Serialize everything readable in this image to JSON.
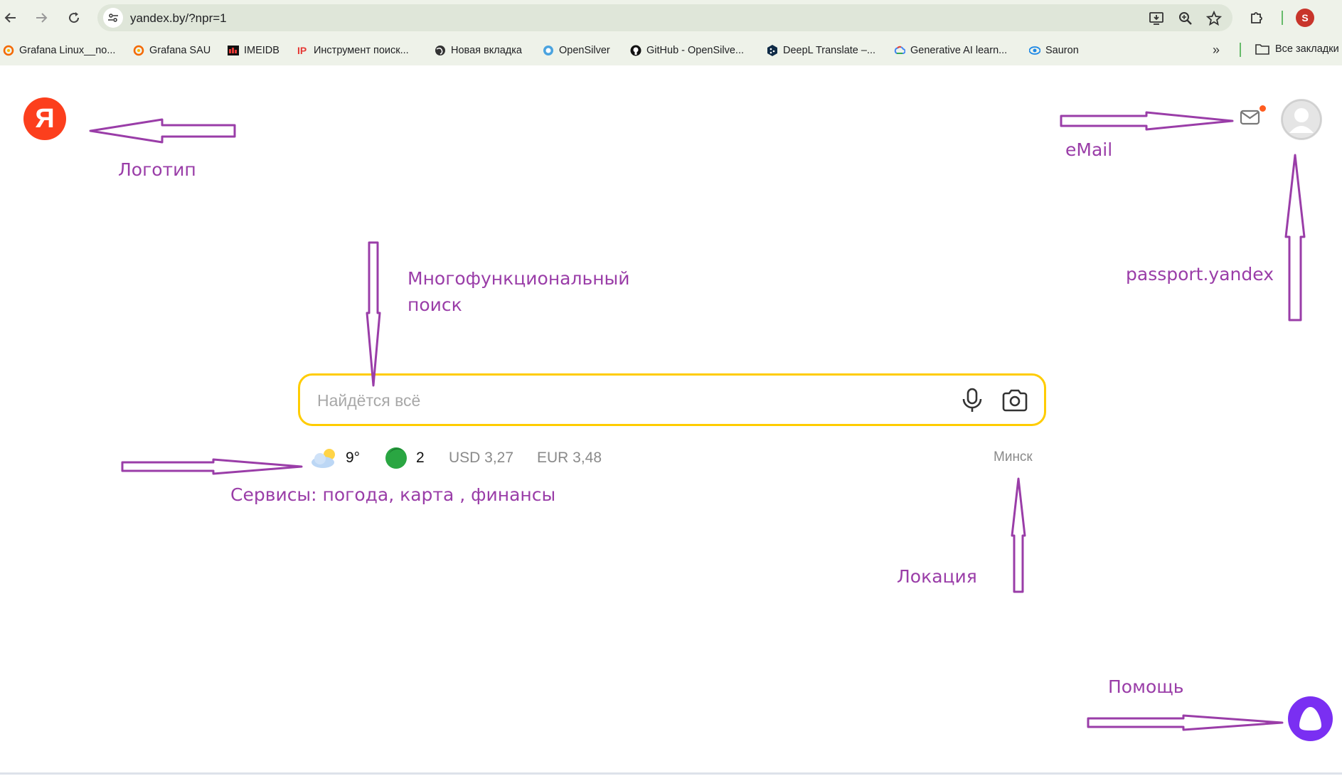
{
  "browser": {
    "url": "yandex.by/?npr=1",
    "profile_initial": "S",
    "bookmarks": [
      {
        "label": "Grafana Linux__no...",
        "icon": "grafana-icon"
      },
      {
        "label": "Grafana SAU",
        "icon": "grafana-icon"
      },
      {
        "label": "IMEIDB",
        "icon": "imeidb-icon"
      },
      {
        "label": "Инструмент поиск...",
        "icon": "ip-icon"
      },
      {
        "label": "Новая вкладка",
        "icon": "globe-icon"
      },
      {
        "label": "OpenSilver",
        "icon": "opensilver-icon"
      },
      {
        "label": "GitHub - OpenSilve...",
        "icon": "github-icon"
      },
      {
        "label": "DeepL Translate –...",
        "icon": "deepl-icon"
      },
      {
        "label": "Generative AI learn...",
        "icon": "google-cloud-icon"
      },
      {
        "label": "Sauron",
        "icon": "sauron-icon"
      }
    ],
    "more_bookmarks": "»",
    "all_bookmarks": "Все закладки"
  },
  "page": {
    "logo_letter": "Я",
    "search": {
      "placeholder": "Найдётся всё",
      "value": ""
    },
    "services": {
      "weather": "9°",
      "traffic": "2",
      "usd": "USD 3,27",
      "eur": "EUR 3,48"
    },
    "city": "Минск"
  },
  "annotations": {
    "logo": "Логотип",
    "email": "eMail",
    "passport": "passport.yandex",
    "search_line1": "Многофункциональный",
    "search_line2": "поиск",
    "services": "Сервисы: погода, карта , финансы",
    "location": "Локация",
    "help": "Помощь"
  },
  "colors": {
    "annotation": "#9a3da8",
    "yandex_red": "#fc3f1d",
    "search_border": "#ffcc00",
    "alice": "#7a2ff2"
  }
}
